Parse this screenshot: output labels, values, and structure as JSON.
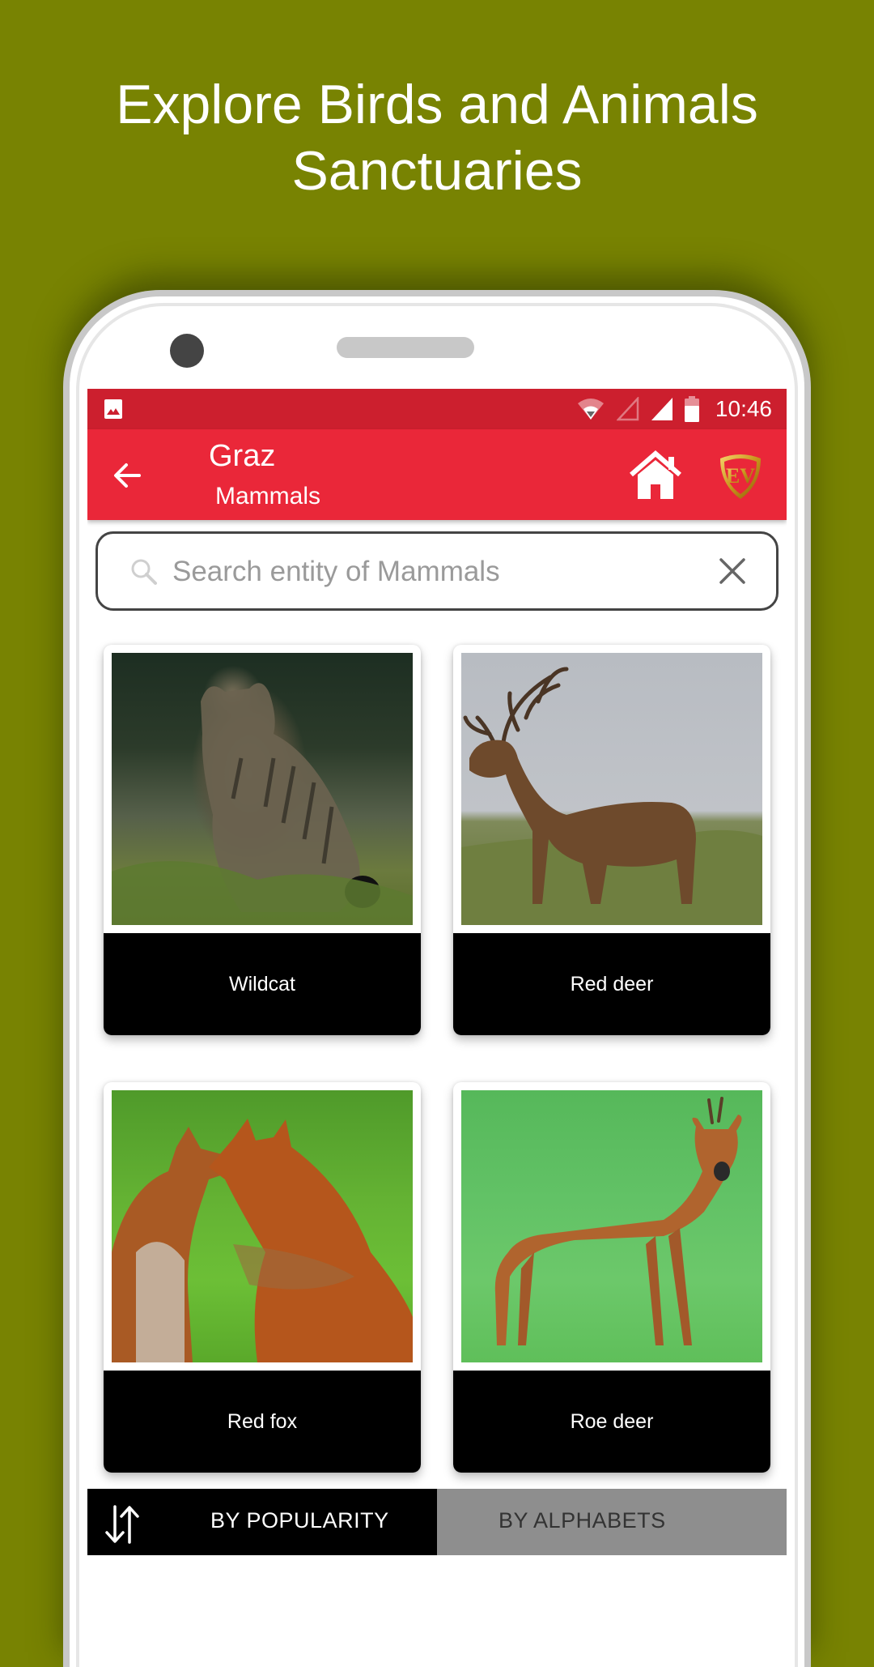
{
  "promo": {
    "headline_line1": "Explore Birds and Animals",
    "headline_line2": "Sanctuaries",
    "background_color": "#788302"
  },
  "status_bar": {
    "time": "10:46",
    "icons": [
      "image-notification-icon",
      "wifi-icon",
      "signal-empty-icon",
      "signal-full-icon",
      "battery-icon"
    ],
    "color": "#CC1F2E"
  },
  "app_bar": {
    "title": "Graz",
    "subtitle": "Mammals",
    "back_icon": "arrow-left-icon",
    "home_icon": "home-icon",
    "logo_text": "EV",
    "color": "#EA2739"
  },
  "search": {
    "placeholder": "Search entity of Mammals",
    "value": ""
  },
  "animals": [
    {
      "name": "Wildcat",
      "image": "wildcat-photo"
    },
    {
      "name": "Red deer",
      "image": "red-deer-photo"
    },
    {
      "name": "Red fox",
      "image": "red-fox-photo"
    },
    {
      "name": "Roe deer",
      "image": "roe-deer-photo"
    }
  ],
  "sort_bar": {
    "sort_icon": "sort-arrows-icon",
    "by_popularity": "BY POPULARITY",
    "by_alphabets": "BY ALPHABETS",
    "active": "BY POPULARITY"
  }
}
